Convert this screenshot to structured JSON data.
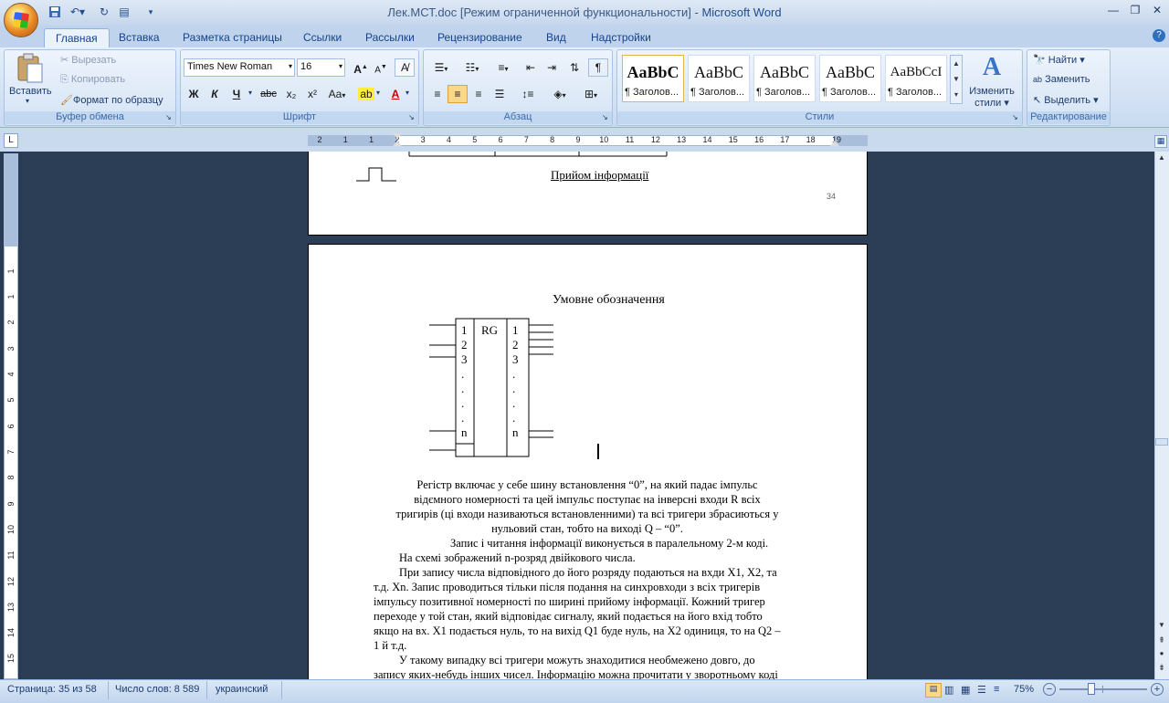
{
  "window": {
    "title_doc": "Лек.МСТ.doc [Режим ограниченной функциональности]",
    "title_sep": " - ",
    "title_app": "Microsoft Word"
  },
  "tabs": [
    "Главная",
    "Вставка",
    "Разметка страницы",
    "Ссылки",
    "Рассылки",
    "Рецензирование",
    "Вид",
    "Надстройки"
  ],
  "clipboard": {
    "paste": "Вставить",
    "cut": "Вырезать",
    "copy": "Копировать",
    "format_painter": "Формат по образцу",
    "label": "Буфер обмена"
  },
  "font": {
    "name": "Times New Roman",
    "size": "16",
    "label": "Шрифт",
    "bold": "Ж",
    "italic": "К",
    "underline": "Ч",
    "strike": "abc",
    "subscript": "x₂",
    "superscript": "x²",
    "case": "Aa",
    "grow": "A",
    "shrink": "A"
  },
  "paragraph": {
    "label": "Абзац"
  },
  "styles": {
    "label": "Стили",
    "cards": [
      {
        "preview": "AaBbC",
        "name": "¶ Заголов..."
      },
      {
        "preview": "AaBbC",
        "name": "¶ Заголов..."
      },
      {
        "preview": "AaBbC",
        "name": "¶ Заголов..."
      },
      {
        "preview": "AaBbC",
        "name": "¶ Заголов..."
      },
      {
        "preview": "AaBbCcI",
        "name": "¶ Заголов..."
      }
    ],
    "change": "Изменить",
    "change2": "стили"
  },
  "editing": {
    "label": "Редактирование",
    "find": "Найти",
    "replace": "Заменить",
    "select": "Выделить"
  },
  "ruler": {
    "h": [
      "2",
      "1",
      "1",
      "2",
      "3",
      "4",
      "5",
      "6",
      "7",
      "8",
      "9",
      "10",
      "11",
      "12",
      "13",
      "14",
      "15",
      "16",
      "17",
      "18",
      "19"
    ],
    "v": [
      "1",
      "1",
      "2",
      "3",
      "4",
      "5",
      "6",
      "7",
      "8",
      "9",
      "10",
      "11",
      "12",
      "13",
      "14",
      "15"
    ]
  },
  "page_top": {
    "heading": "Прийом інформації",
    "page_number": "34"
  },
  "page_main": {
    "caption": "Умовне обозначення",
    "symbol": {
      "center": "RG",
      "left_labels": [
        "1",
        "2",
        "3",
        ".",
        ".",
        ".",
        ".",
        "n"
      ],
      "right_labels": [
        "1",
        "2",
        "3",
        ".",
        ".",
        ".",
        ".",
        "n"
      ]
    },
    "lines": [
      "Регістр включає у себе шину встановлення “0”, на який падає імпульс",
      "відємного номерності та цей імпульс поступає на інверсні входи R всіх",
      "тригирів (ці входи називаються встановленними) та всі тригери збрасиються у",
      "нульовий стан, тобто на виході Q – “0”.",
      "Запис і читання інформації виконується в паралельному 2-м коді.",
      "На схемі зображений n-розряд двійкового числа.",
      "При запису числа відповідного до його розряду подаються на вхди X1, X2, та",
      "т.д. Xn. Запис проводиться тільки після подання на синхровходи з всіх тригерів",
      "імпульсу позитивної номерності по ширині прийому інформації. Кожний тригер",
      "переходе у той стан, який відповідає сигналу, який подається на його вхід тобто",
      "якщо на вх. X1 подається нуль, то на вихід Q1 буде нуль, на X2 одиниця, то на Q2 –",
      "1 й т.д.",
      "У такому випадку всі тригери можуть знаходитися необмежено довго, до",
      "запису яких-небудь інших чисел. Інформацію можна прочитати у зворотньому коді"
    ]
  },
  "status": {
    "page": "Страница: 35 из 58",
    "words": "Число слов: 8 589",
    "lang": "украинский",
    "zoom": "75%"
  }
}
